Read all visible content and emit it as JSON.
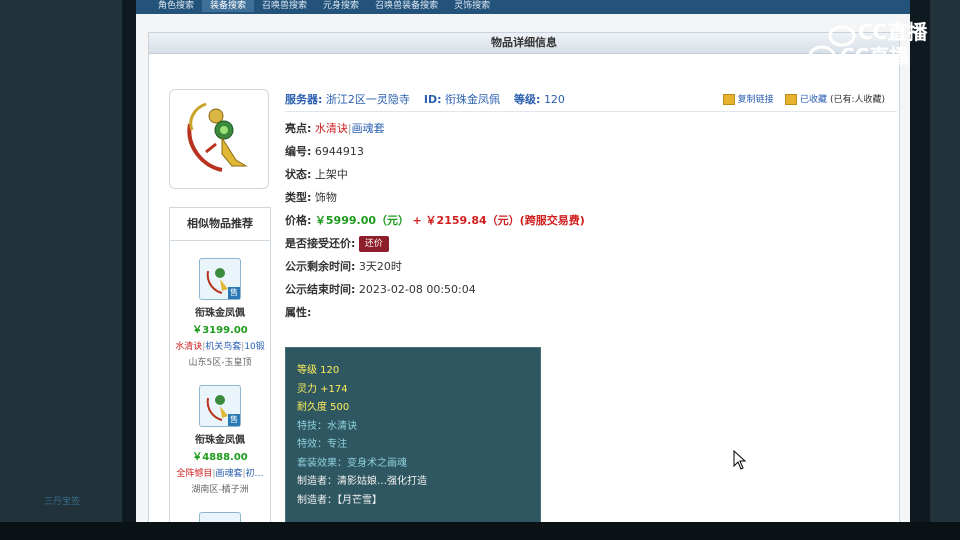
{
  "nav": [
    "角色搜索",
    "装备搜索",
    "召唤兽搜索",
    "元身搜索",
    "召唤兽装备搜索",
    "灵饰搜索"
  ],
  "page_title": "物品详细信息",
  "header": {
    "server_label": "服务器:",
    "server_value": "浙江2区一灵隐寺",
    "id_label": "ID:",
    "id_value": "衔珠金凤佩",
    "level_label": "等级:",
    "level_value": "120",
    "copy_link": "复制链接",
    "favorited": "已收藏",
    "fav_count": "(已有:人收藏)"
  },
  "details": {
    "highlight_label": "亮点:",
    "highlight_tag1": "水清诀",
    "highlight_sep": "|",
    "highlight_tag2": "画魂套",
    "number_label": "编号:",
    "number_value": "6944913",
    "status_label": "状态:",
    "status_value": "上架中",
    "type_label": "类型:",
    "type_value": "饰物",
    "price_label": "价格:",
    "price_value": "￥5999.00（元）",
    "price_extra": "+ ￥2159.84（元）(跨服交易费)",
    "counter_label": "是否接受还价:",
    "counter_button": "还价",
    "remain_label": "公示剩余时间:",
    "remain_value": "3天20时",
    "end_label": "公示结束时间:",
    "end_value": "2023-02-08 00:50:04",
    "attr_label": "属性:"
  },
  "attributes": [
    "等级 120",
    "灵力 +174",
    "耐久度 500",
    "特技：水清诀",
    "特效：专注",
    "套装效果：变身术之画魂",
    "制造者：清影姑娘…强化打造",
    "制造者：【月芒雪】"
  ],
  "similar": {
    "title": "相似物品推荐",
    "items": [
      {
        "name": "衔珠金凤佩",
        "price": "￥3199.00",
        "tag1": "水清诀",
        "tag2": "机关鸟套",
        "tag3": "10锻",
        "server": "山东5区-玉皇顶"
      },
      {
        "name": "衔珠金凤佩",
        "price": "￥4888.00",
        "tag1": "全阵憾目",
        "tag2": "画魂套",
        "tag3": "初…",
        "server": "湖南区-橘子洲"
      }
    ]
  },
  "badge_char": "售",
  "watermark": "CC直播",
  "left_blur_text": "三丹宝签"
}
